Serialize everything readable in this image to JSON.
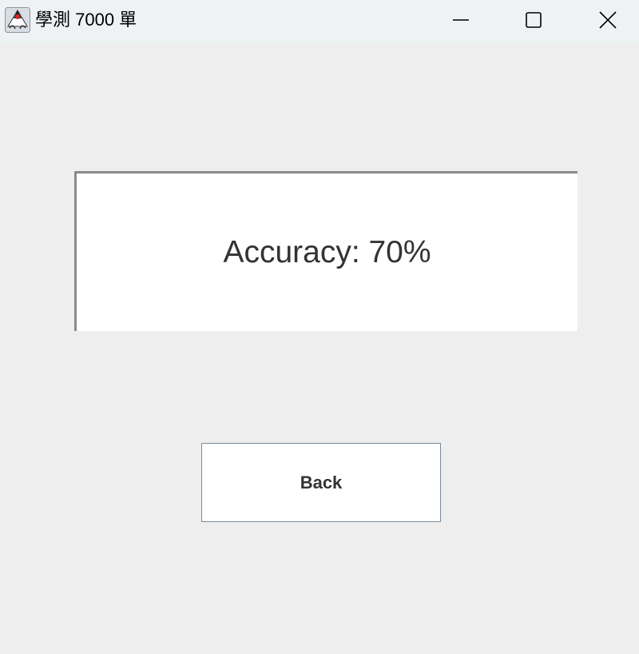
{
  "window": {
    "title": "學測 7000 單",
    "icon": "java-duke-icon"
  },
  "titlebar_controls": {
    "minimize": "minimize-icon",
    "maximize": "maximize-icon",
    "close": "close-icon"
  },
  "result": {
    "accuracy_text": "Accuracy: 70%"
  },
  "actions": {
    "back_label": "Back"
  },
  "colors": {
    "titlebar_bg": "#eef2f5",
    "window_bg": "#eeeeee",
    "panel_bg": "#ffffff",
    "text": "#333333"
  }
}
